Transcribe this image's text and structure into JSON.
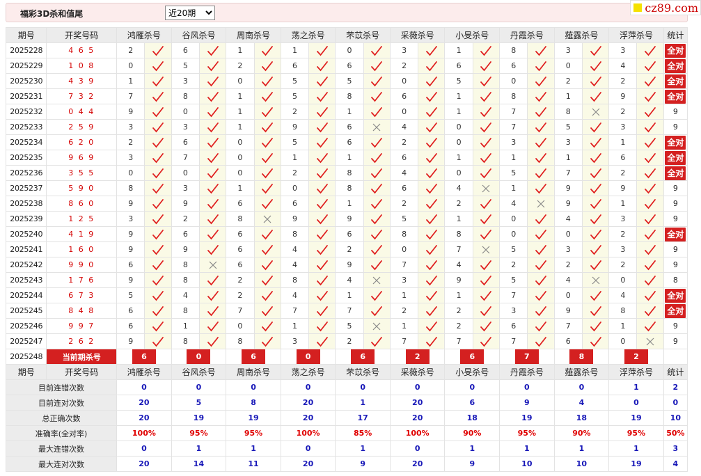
{
  "toolbar": {
    "title": "福彩3D杀和值尾",
    "period_select": "近20期",
    "period_options": [
      "近20期"
    ]
  },
  "brand": {
    "text": "cz89.com"
  },
  "columns": {
    "period": "期号",
    "winning": "开奖号码",
    "stats": "统计"
  },
  "experts": [
    "鸿雁杀号",
    "谷风杀号",
    "周南杀号",
    "荡之杀号",
    "芣苡杀号",
    "采薇杀号",
    "小旻杀号",
    "丹霞杀号",
    "薤露杀号",
    "浮萍杀号"
  ],
  "all_correct_label": "全对",
  "rows": [
    {
      "period": "2025228",
      "number": "4 6 5",
      "values": [
        2,
        6,
        1,
        1,
        0,
        3,
        1,
        8,
        3,
        3
      ],
      "ok": [
        1,
        1,
        1,
        1,
        1,
        1,
        1,
        1,
        1,
        1
      ],
      "stat": "全对"
    },
    {
      "period": "2025229",
      "number": "1 0 8",
      "values": [
        0,
        5,
        2,
        6,
        6,
        2,
        6,
        6,
        0,
        4
      ],
      "ok": [
        1,
        1,
        1,
        1,
        1,
        1,
        1,
        1,
        1,
        1
      ],
      "stat": "全对"
    },
    {
      "period": "2025230",
      "number": "4 3 9",
      "values": [
        1,
        3,
        0,
        5,
        5,
        0,
        5,
        0,
        2,
        2
      ],
      "ok": [
        1,
        1,
        1,
        1,
        1,
        1,
        1,
        1,
        1,
        1
      ],
      "stat": "全对"
    },
    {
      "period": "2025231",
      "number": "7 3 2",
      "values": [
        7,
        8,
        1,
        5,
        8,
        6,
        1,
        8,
        1,
        9
      ],
      "ok": [
        1,
        1,
        1,
        1,
        1,
        1,
        1,
        1,
        1,
        1
      ],
      "stat": "全对"
    },
    {
      "period": "2025232",
      "number": "0 4 4",
      "values": [
        9,
        0,
        1,
        2,
        1,
        0,
        1,
        7,
        8,
        2
      ],
      "ok": [
        1,
        1,
        1,
        1,
        1,
        1,
        1,
        1,
        0,
        1
      ],
      "stat": "9"
    },
    {
      "period": "2025233",
      "number": "2 5 9",
      "values": [
        3,
        3,
        1,
        9,
        6,
        4,
        0,
        7,
        5,
        3
      ],
      "ok": [
        1,
        1,
        1,
        1,
        0,
        1,
        1,
        1,
        1,
        1
      ],
      "stat": "9"
    },
    {
      "period": "2025234",
      "number": "6 2 0",
      "values": [
        2,
        6,
        0,
        5,
        6,
        2,
        0,
        3,
        3,
        1
      ],
      "ok": [
        1,
        1,
        1,
        1,
        1,
        1,
        1,
        1,
        1,
        1
      ],
      "stat": "全对"
    },
    {
      "period": "2025235",
      "number": "9 6 9",
      "values": [
        3,
        7,
        0,
        1,
        1,
        6,
        1,
        1,
        1,
        6
      ],
      "ok": [
        1,
        1,
        1,
        1,
        1,
        1,
        1,
        1,
        1,
        1
      ],
      "stat": "全对"
    },
    {
      "period": "2025236",
      "number": "3 5 5",
      "values": [
        0,
        0,
        0,
        2,
        8,
        4,
        0,
        5,
        7,
        2
      ],
      "ok": [
        1,
        1,
        1,
        1,
        1,
        1,
        1,
        1,
        1,
        1
      ],
      "stat": "全对"
    },
    {
      "period": "2025237",
      "number": "5 9 0",
      "values": [
        8,
        3,
        1,
        0,
        8,
        6,
        4,
        1,
        9,
        9
      ],
      "ok": [
        1,
        1,
        1,
        1,
        1,
        1,
        0,
        1,
        1,
        1
      ],
      "stat": "9"
    },
    {
      "period": "2025238",
      "number": "8 6 0",
      "values": [
        9,
        9,
        6,
        6,
        1,
        2,
        2,
        4,
        9,
        1
      ],
      "ok": [
        1,
        1,
        1,
        1,
        1,
        1,
        1,
        0,
        1,
        1
      ],
      "stat": "9"
    },
    {
      "period": "2025239",
      "number": "1 2 5",
      "values": [
        3,
        2,
        8,
        9,
        9,
        5,
        1,
        0,
        4,
        3
      ],
      "ok": [
        1,
        1,
        0,
        1,
        1,
        1,
        1,
        1,
        1,
        1
      ],
      "stat": "9"
    },
    {
      "period": "2025240",
      "number": "4 1 9",
      "values": [
        9,
        6,
        6,
        8,
        6,
        8,
        8,
        0,
        0,
        2
      ],
      "ok": [
        1,
        1,
        1,
        1,
        1,
        1,
        1,
        1,
        1,
        1
      ],
      "stat": "全对"
    },
    {
      "period": "2025241",
      "number": "1 6 0",
      "values": [
        9,
        9,
        6,
        4,
        2,
        0,
        7,
        5,
        3,
        3
      ],
      "ok": [
        1,
        1,
        1,
        1,
        1,
        1,
        0,
        1,
        1,
        1
      ],
      "stat": "9"
    },
    {
      "period": "2025242",
      "number": "9 9 0",
      "values": [
        6,
        8,
        6,
        4,
        9,
        7,
        4,
        2,
        2,
        2
      ],
      "ok": [
        1,
        0,
        1,
        1,
        1,
        1,
        1,
        1,
        1,
        1
      ],
      "stat": "9"
    },
    {
      "period": "2025243",
      "number": "1 7 6",
      "values": [
        9,
        8,
        2,
        8,
        4,
        3,
        9,
        5,
        4,
        0
      ],
      "ok": [
        1,
        1,
        1,
        1,
        0,
        1,
        1,
        1,
        0,
        1
      ],
      "stat": "8"
    },
    {
      "period": "2025244",
      "number": "6 7 3",
      "values": [
        5,
        4,
        2,
        4,
        1,
        1,
        1,
        7,
        0,
        4
      ],
      "ok": [
        1,
        1,
        1,
        1,
        1,
        1,
        1,
        1,
        1,
        1
      ],
      "stat": "全对"
    },
    {
      "period": "2025245",
      "number": "8 4 8",
      "values": [
        6,
        8,
        7,
        7,
        7,
        2,
        2,
        3,
        9,
        8
      ],
      "ok": [
        1,
        1,
        1,
        1,
        1,
        1,
        1,
        1,
        1,
        1
      ],
      "stat": "全对"
    },
    {
      "period": "2025246",
      "number": "9 9 7",
      "values": [
        6,
        1,
        0,
        1,
        5,
        1,
        2,
        6,
        7,
        1
      ],
      "ok": [
        1,
        1,
        1,
        1,
        0,
        1,
        1,
        1,
        1,
        1
      ],
      "stat": "9"
    },
    {
      "period": "2025247",
      "number": "2 6 2",
      "values": [
        9,
        8,
        8,
        3,
        2,
        7,
        7,
        7,
        6,
        0
      ],
      "ok": [
        1,
        1,
        1,
        1,
        1,
        1,
        1,
        1,
        1,
        0
      ],
      "stat": "9"
    }
  ],
  "current": {
    "period": "2025248",
    "label": "当前期杀号",
    "values": [
      "6",
      "0",
      "6",
      "0",
      "6",
      "2",
      "6",
      "7",
      "8",
      "2"
    ]
  },
  "summary": [
    {
      "label": "目前连错次数",
      "values": [
        "0",
        "0",
        "0",
        "0",
        "0",
        "0",
        "0",
        "0",
        "0",
        "1"
      ],
      "stat": "2",
      "red": false
    },
    {
      "label": "目前连对次数",
      "values": [
        "20",
        "5",
        "8",
        "20",
        "1",
        "20",
        "6",
        "9",
        "4",
        "0"
      ],
      "stat": "0",
      "red": false
    },
    {
      "label": "总正确次数",
      "values": [
        "20",
        "19",
        "19",
        "20",
        "17",
        "20",
        "18",
        "19",
        "18",
        "19"
      ],
      "stat": "10",
      "red": false
    },
    {
      "label": "准确率(全对率)",
      "values": [
        "100%",
        "95%",
        "95%",
        "100%",
        "85%",
        "100%",
        "90%",
        "95%",
        "90%",
        "95%"
      ],
      "stat": "50%",
      "red": true
    },
    {
      "label": "最大连错次数",
      "values": [
        "0",
        "1",
        "1",
        "0",
        "1",
        "0",
        "1",
        "1",
        "1",
        "1"
      ],
      "stat": "3",
      "red": false
    },
    {
      "label": "最大连对次数",
      "values": [
        "20",
        "14",
        "11",
        "20",
        "9",
        "20",
        "9",
        "10",
        "10",
        "19"
      ],
      "stat": "4",
      "red": false
    }
  ],
  "colors": {
    "accent_red": "#d42020",
    "summary_blue": "#1818b8",
    "header_bg": "#ececec",
    "mark_bg": "#fafae6",
    "check": "#e02020",
    "cross": "#8a8a8a"
  }
}
